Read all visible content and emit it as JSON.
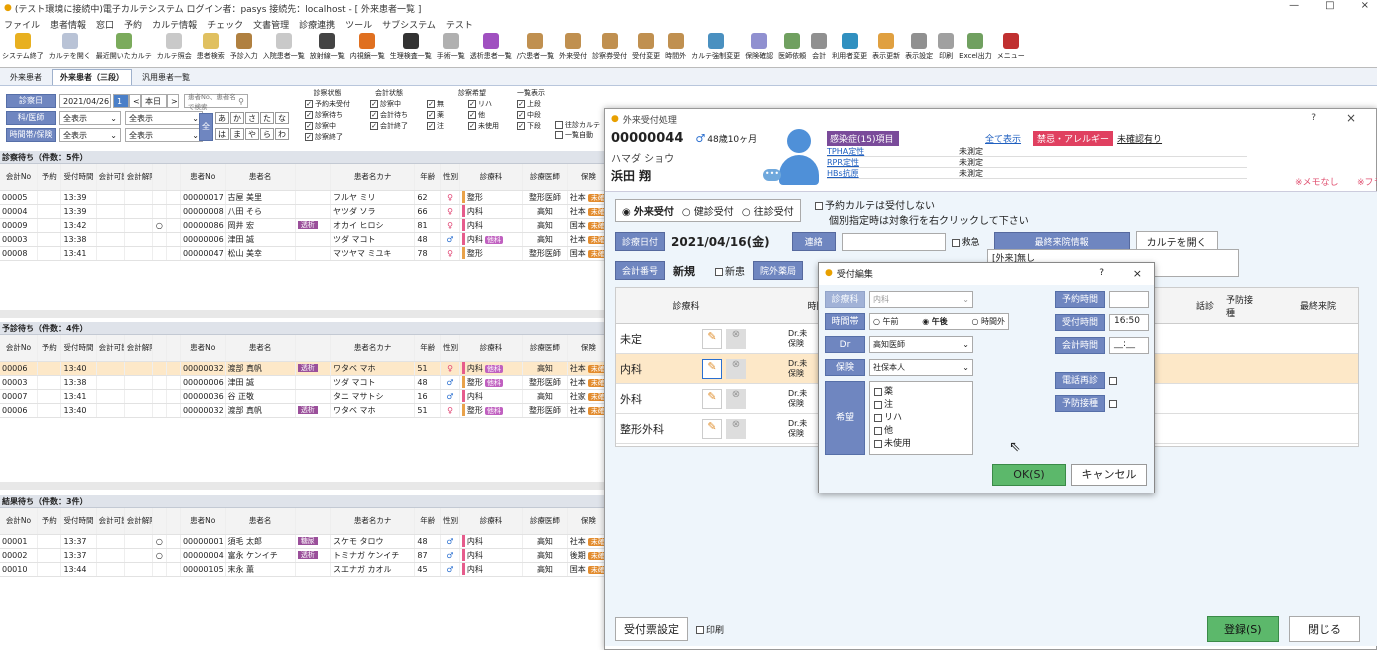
{
  "window": {
    "title": "(テスト環境に接続中)電子カルテシステム  ログイン者：pasys  接続先：localhost - [ 外来患者一覧 ]",
    "min": "—",
    "max": "□",
    "close": "×"
  },
  "menu": [
    "ファイル",
    "患者情報",
    "窓口",
    "予約",
    "カルテ情報",
    "チェック",
    "文書管理",
    "診療連携",
    "ツール",
    "サブシステム",
    "テスト"
  ],
  "toolbar": [
    {
      "label": "システム終了",
      "color": "#e8b020"
    },
    {
      "label": "カルテを開く",
      "color": "#b9c3d6"
    },
    {
      "label": "最近開いたカルテ",
      "color": "#7bab5c"
    },
    {
      "label": "カルテ照会",
      "color": "#c9c9c9"
    },
    {
      "label": "患者検索",
      "color": "#e0c060"
    },
    {
      "label": "予診入力",
      "color": "#b08040"
    },
    {
      "label": "入院患者一覧",
      "color": "#c9c9c9"
    },
    {
      "label": "放射線一覧",
      "color": "#444444"
    },
    {
      "label": "内視鏡一覧",
      "color": "#e07020"
    },
    {
      "label": "生理検査一覧",
      "color": "#333333"
    },
    {
      "label": "手術一覧",
      "color": "#b0b0b0"
    },
    {
      "label": "透析患者一覧",
      "color": "#a050c0"
    },
    {
      "label": "/穴患者一覧",
      "color": "#c09050"
    },
    {
      "label": "外来受付",
      "color": "#c09050"
    },
    {
      "label": "診察券受付",
      "color": "#c09050"
    },
    {
      "label": "受付変更",
      "color": "#c09050"
    },
    {
      "label": "時間外",
      "color": "#c09050"
    },
    {
      "label": "カルテ強制変更",
      "color": "#4a90c0"
    },
    {
      "label": "保険確認",
      "color": "#9090d0"
    },
    {
      "label": "医師依頼",
      "color": "#70a060"
    },
    {
      "label": "会計",
      "color": "#909090"
    },
    {
      "label": "利用者変更",
      "color": "#3090c0"
    },
    {
      "label": "表示更新",
      "color": "#e0a040"
    },
    {
      "label": "表示設定",
      "color": "#909090"
    },
    {
      "label": "印刷",
      "color": "#a0a0a0"
    },
    {
      "label": "Excel出力",
      "color": "#70a060"
    },
    {
      "label": "メニュー",
      "color": "#c03030"
    }
  ],
  "tabs": [
    "外来患者",
    "外来患者（三段）",
    "汎用患者一覧"
  ],
  "filter": {
    "shinsatsu_btn": "診察日",
    "date": "2021/04/26",
    "day": "1",
    "prev": "<",
    "today": "本日",
    "next": ">",
    "search_placeholder": "患者No、患者名で検索",
    "ka_btn": "科/医師",
    "hoken_btn": "時間帯/保険",
    "sel1": "全表示",
    "sel2": "全表示",
    "sel3": "全表示",
    "sel4": "全表示",
    "all": "全",
    "kana1": [
      "あ",
      "か",
      "さ",
      "た",
      "な"
    ],
    "kana2": [
      "は",
      "ま",
      "や",
      "ら",
      "わ"
    ],
    "status_title": "診察状態",
    "status": [
      "予約未受付",
      "診察待ち",
      "診察中",
      "診察終了"
    ],
    "kaikei_title": "会計状態",
    "kaikei": [
      "診察中",
      "会計待ち",
      "会計終了"
    ],
    "kibou_title": "診察希望",
    "kibou": [
      "無",
      "リハ",
      "薬",
      "他",
      "注",
      "未使用"
    ],
    "ichiran_title": "一覧表示",
    "ichiran": [
      "上段",
      "中段",
      "下段"
    ],
    "extra": [
      "往診カルテ",
      "一覧自動"
    ]
  },
  "headers": [
    "会計No",
    "予約",
    "受付時間",
    "会計可能",
    "会計解除",
    "",
    "",
    "患者No",
    "患者名",
    "",
    "患者名カナ",
    "年齢",
    "性別",
    "診療科",
    "診療医師",
    "保険"
  ],
  "section1": {
    "title": "診察待ち（件数：5件）",
    "rows": [
      {
        "no": "00005",
        "time": "13:39",
        "pno": "00000017",
        "name": "古屋 美里",
        "kana": "フルヤ ミリ",
        "age": "62",
        "sex": "F",
        "ka": "整形",
        "ka2": "",
        "dr": "整形医師",
        "ins": "社本",
        "st": "未確認",
        "mark": "",
        "badge": ""
      },
      {
        "no": "00004",
        "time": "13:39",
        "pno": "00000008",
        "name": "八田 そら",
        "kana": "ヤツダ ソラ",
        "age": "66",
        "sex": "F",
        "ka": "内科",
        "ka2": "",
        "dr": "高知",
        "ins": "社本",
        "st": "未確認",
        "mark": "",
        "badge": ""
      },
      {
        "no": "00009",
        "time": "13:42",
        "pno": "00000086",
        "name": "岡井 宏",
        "kana": "オカイ ヒロシ",
        "age": "81",
        "sex": "F",
        "ka": "内科",
        "ka2": "",
        "dr": "高知",
        "ins": "国本",
        "st": "未確認",
        "mark": "○",
        "badge": "透析"
      },
      {
        "no": "00003",
        "time": "13:38",
        "pno": "00000006",
        "name": "津田 誠",
        "kana": "ツダ マコト",
        "age": "48",
        "sex": "M",
        "ka": "内科",
        "ka2": "他科",
        "dr": "高知",
        "ins": "社本",
        "st": "未確認",
        "mark": "",
        "badge": ""
      },
      {
        "no": "00008",
        "time": "13:41",
        "pno": "00000047",
        "name": "松山 美幸",
        "kana": "マツヤマ ミユキ",
        "age": "78",
        "sex": "F",
        "ka": "整形",
        "ka2": "",
        "dr": "整形医師",
        "ins": "国本",
        "st": "未確認",
        "mark": "",
        "badge": ""
      }
    ]
  },
  "section2": {
    "title": "予診待ち（件数：4件）",
    "rows": [
      {
        "no": "00006",
        "time": "13:40",
        "pno": "00000032",
        "name": "渡部 真帆",
        "kana": "ワタベ マホ",
        "age": "51",
        "sex": "F",
        "ka": "内科",
        "ka2": "他科",
        "dr": "高知",
        "ins": "社本",
        "st": "未確認",
        "mark": "",
        "badge": "透析"
      },
      {
        "no": "00003",
        "time": "13:38",
        "pno": "00000006",
        "name": "津田 誠",
        "kana": "ツダ マコト",
        "age": "48",
        "sex": "M",
        "ka": "整形",
        "ka2": "他科",
        "dr": "整形医師",
        "ins": "社本",
        "st": "未確認",
        "mark": "",
        "badge": ""
      },
      {
        "no": "00007",
        "time": "13:41",
        "pno": "00000036",
        "name": "谷 正敬",
        "kana": "タニ マサトシ",
        "age": "16",
        "sex": "M",
        "ka": "内科",
        "ka2": "",
        "dr": "高知",
        "ins": "社家",
        "st": "未確認",
        "mark": "",
        "badge": ""
      },
      {
        "no": "00006",
        "time": "13:40",
        "pno": "00000032",
        "name": "渡部 真帆",
        "kana": "ワタベ マホ",
        "age": "51",
        "sex": "F",
        "ka": "整形",
        "ka2": "他科",
        "dr": "整形医師",
        "ins": "社本",
        "st": "未確認",
        "mark": "",
        "badge": "透析"
      }
    ]
  },
  "section3": {
    "title": "結果待ち（件数：3件）",
    "rows": [
      {
        "no": "00001",
        "time": "13:37",
        "pno": "00000001",
        "name": "須毛 太郎",
        "kana": "スケモ タロウ",
        "age": "48",
        "sex": "M",
        "ka": "内科",
        "ka2": "",
        "dr": "高知",
        "ins": "社本",
        "st": "未確認",
        "mark": "○",
        "badge": "糖尿"
      },
      {
        "no": "00002",
        "time": "13:37",
        "pno": "00000004",
        "name": "富永 ケンイチ",
        "kana": "トミナガ ケンイチ",
        "age": "87",
        "sex": "M",
        "ka": "内科",
        "ka2": "",
        "dr": "高知",
        "ins": "後期",
        "st": "未確認",
        "mark": "○",
        "badge": "透析"
      },
      {
        "no": "00010",
        "time": "13:44",
        "pno": "00000105",
        "name": "末永 薫",
        "kana": "スエナガ カオル",
        "age": "45",
        "sex": "M",
        "ka": "内科",
        "ka2": "",
        "dr": "高知",
        "ins": "国本",
        "st": "未確認",
        "mark": "",
        "badge": ""
      }
    ]
  },
  "dialog": {
    "title": "外来受付処理",
    "help": "?",
    "close": "×",
    "pid": "00000044",
    "age": "48歳10ヶ月",
    "kana": "ハマダ ショウ",
    "name": "浜田 翔",
    "infect": "感染症(15)項目",
    "showall": "全て表示",
    "allergy": "禁忌・アレルギー",
    "unconfirmed": "未確認有り",
    "tests": [
      {
        "n": "TPHA定性",
        "v": "未測定"
      },
      {
        "n": "RPR定性",
        "v": "未測定"
      },
      {
        "n": "HBs抗原",
        "v": "未測定"
      }
    ],
    "memo": "※メモなし",
    "flag": "※フラグなし",
    "radios": [
      "外来受付",
      "健診受付",
      "往診受付"
    ],
    "norec": "予約カルテは受付しない",
    "norec2": "個別指定時は対象行を右クリックして下さい",
    "date_lbl": "診療日付",
    "date": "2021/04/16(金)",
    "renraku": "連絡",
    "kyukyu": "救急",
    "last_lbl": "最終来院情報",
    "open_karte": "カルテを開く",
    "last_val": "[外来]無し",
    "kaikei_lbl": "会計番号",
    "kaikei_val": "新規",
    "shinkan": "新患",
    "kogai": "院外薬局",
    "table_hdr": [
      "診療科",
      "時間帯",
      "話診",
      "予防接種",
      "最終来院"
    ],
    "depts": [
      {
        "n": "未定",
        "dr": "Dr.未",
        "ins": "保険"
      },
      {
        "n": "内科",
        "dr": "Dr.未",
        "ins": "保険"
      },
      {
        "n": "外科",
        "dr": "Dr.未",
        "ins": "保険"
      },
      {
        "n": "整形外科",
        "dr": "Dr.未",
        "ins": "保険"
      }
    ],
    "ticket": "受付票設定",
    "print": "印刷",
    "register": "登録(S)",
    "close_btn": "閉じる"
  },
  "edit": {
    "title": "受付編集",
    "help": "?",
    "close": "×",
    "dept_lbl": "診療科",
    "dept": "内科",
    "time_lbl": "時間帯",
    "am": "午前",
    "pm": "午後",
    "ext": "時間外",
    "dr_lbl": "Dr",
    "dr": "高知医師",
    "ins_lbl": "保険",
    "ins": "社保本人",
    "hope_lbl": "希望",
    "hopes": [
      "薬",
      "注",
      "リハ",
      "他",
      "未使用"
    ],
    "yoyaku": "予約時間",
    "uketsuke": "受付時間",
    "uk_val": "16:50",
    "kaikei": "会計時間",
    "kk_val": "__:__",
    "tel": "電話再診",
    "yobo": "予防接種",
    "ok": "OK(S)",
    "cancel": "キャンセル"
  }
}
